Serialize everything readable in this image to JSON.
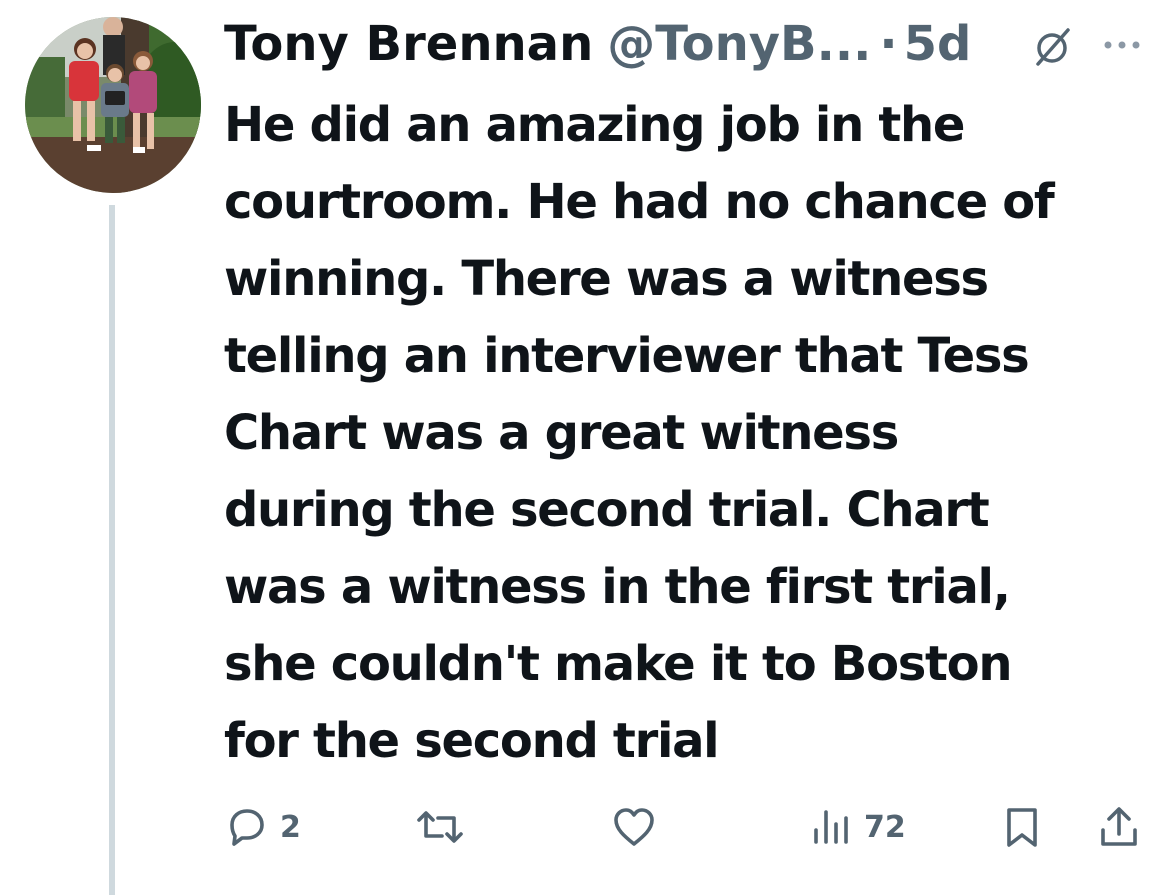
{
  "tweet": {
    "display_name": "Tony Brennan",
    "handle": "@TonyB...",
    "separator": "·",
    "time": "5d",
    "text": "He did an amazing job in the\ncourtroom. He had no chance of\nwinning. There was a witness\ntelling an interviewer that Tess\nChart was a great witness\nduring the second trial. Chart\nwas a witness in the first trial,\nshe couldn't make it to Boston\nfor the second trial"
  },
  "actions": {
    "reply_count": "2",
    "retweet_count": "",
    "like_count": "",
    "views_count": "72"
  },
  "icons": {
    "reply": "reply-icon",
    "retweet": "retweet-icon",
    "like": "heart-icon",
    "views": "views-icon",
    "bookmark": "bookmark-icon",
    "share": "share-icon",
    "grok": "grok-icon",
    "more": "more-icon"
  },
  "colors": {
    "text": "#0f1419",
    "secondary": "#536471",
    "thread_line": "#cfd9de"
  }
}
